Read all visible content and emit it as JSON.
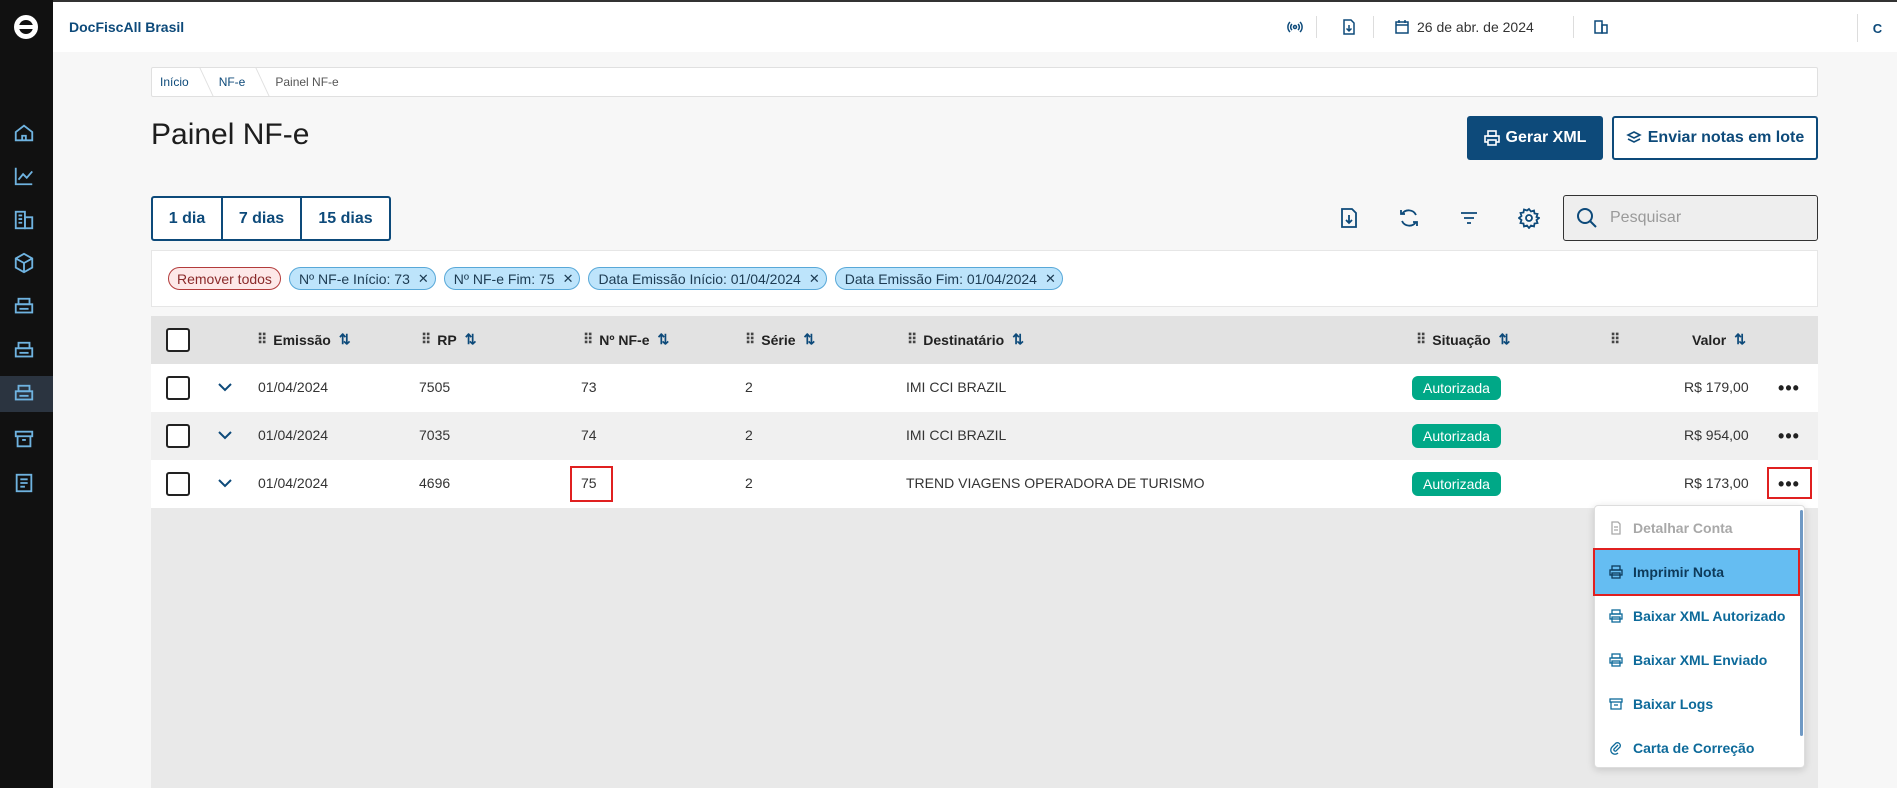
{
  "app": {
    "title": "DocFiscAll Brasil",
    "date": "26 de abr. de 2024",
    "user_initial": "C"
  },
  "breadcrumb": [
    "Início",
    "NF-e",
    "Painel NF-e"
  ],
  "page": {
    "title": "Painel NF-e"
  },
  "actions": {
    "gerar_xml": "Gerar XML",
    "enviar_lote": "Enviar notas em lote"
  },
  "periods": [
    "1 dia",
    "7 dias",
    "15 dias"
  ],
  "search": {
    "placeholder": "Pesquisar",
    "value": ""
  },
  "filters": {
    "remove_all": "Remover todos",
    "chips": [
      "Nº NF-e Início: 73",
      "Nº NF-e Fim: 75",
      "Data Emissão Início: 01/04/2024",
      "Data Emissão Fim: 01/04/2024"
    ]
  },
  "table": {
    "columns": [
      "Emissão",
      "RP",
      "Nº NF-e",
      "Série",
      "Destinatário",
      "Situação",
      "Valor"
    ],
    "rows": [
      {
        "emissao": "01/04/2024",
        "rp": "7505",
        "nfe": "73",
        "serie": "2",
        "destinatario": "IMI CCI BRAZIL",
        "situacao": "Autorizada",
        "valor": "R$ 179,00"
      },
      {
        "emissao": "01/04/2024",
        "rp": "7035",
        "nfe": "74",
        "serie": "2",
        "destinatario": "IMI CCI BRAZIL",
        "situacao": "Autorizada",
        "valor": "R$ 954,00"
      },
      {
        "emissao": "01/04/2024",
        "rp": "4696",
        "nfe": "75",
        "serie": "2",
        "destinatario": "TREND VIAGENS OPERADORA DE TURISMO",
        "situacao": "Autorizada",
        "valor": "R$ 173,00"
      }
    ]
  },
  "menu": {
    "items": [
      "Detalhar Conta",
      "Imprimir Nota",
      "Baixar XML Autorizado",
      "Baixar XML Enviado",
      "Baixar Logs",
      "Carta de Correção"
    ]
  },
  "colors": {
    "primary": "#0d4a7a",
    "success": "#00a887",
    "highlight": "#e02020",
    "menu_active": "#65bdf2"
  }
}
